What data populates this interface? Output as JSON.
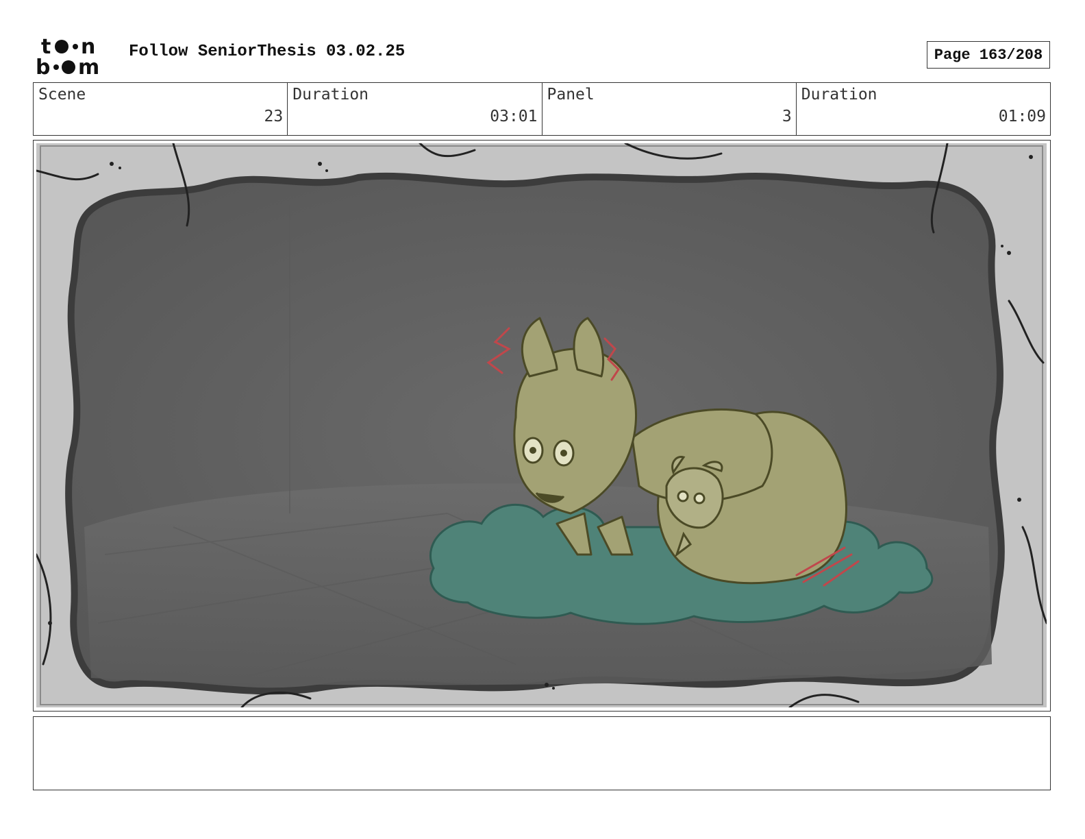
{
  "header": {
    "logo_text": "toon boom",
    "title": "Follow SeniorThesis 03.02.25",
    "page": "Page 163/208"
  },
  "info": {
    "scene_label": "Scene",
    "scene_value": "23",
    "scene_duration_label": "Duration",
    "scene_duration_value": "03:01",
    "panel_label": "Panel",
    "panel_value": "3",
    "panel_duration_label": "Duration",
    "panel_duration_value": "01:09"
  },
  "panel": {
    "description": "",
    "colors": {
      "wall": "#5e5e5e",
      "frame_stone": "#bdbdbd",
      "fox": "#a3a274",
      "fox_line": "#4b4a26",
      "bush": "#4f8378",
      "accent_red": "#c0474b"
    }
  },
  "notes": {
    "text": ""
  }
}
